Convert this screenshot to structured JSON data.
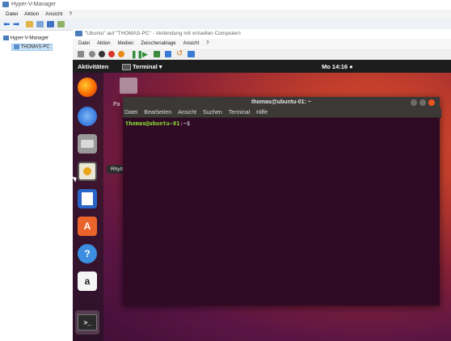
{
  "host": {
    "title": "Hyper-V-Manager",
    "menu": [
      "Datei",
      "Aktion",
      "Ansicht",
      "?"
    ],
    "tree": {
      "root": "Hyper-V-Manager",
      "child": "THOMAS-PC"
    }
  },
  "vm": {
    "title": "\"Ubuntu\" auf \"THOMAS-PC\" - Verbindung mit virtuellen Computern",
    "menu": [
      "Datei",
      "Aktion",
      "Medien",
      "Zwischenablage",
      "Ansicht",
      "?"
    ]
  },
  "ubuntu": {
    "activities": "Aktivitäten",
    "app_menu": "Terminal ▾",
    "clock": "Mo 14:16 ●",
    "tooltip": "Rhythmbox",
    "desktop_partial": "Pa",
    "dock": [
      {
        "icon": "firefox-icon",
        "color": "#e66000"
      },
      {
        "icon": "thunderbird-icon",
        "color": "#2a6fdb"
      },
      {
        "icon": "files-icon",
        "color": "#8a8a8a"
      },
      {
        "icon": "rhythmbox-icon",
        "color": "#e8e3d4"
      },
      {
        "icon": "writer-icon",
        "color": "#2a66c8"
      },
      {
        "icon": "software-center-icon",
        "color": "#e9632b"
      },
      {
        "icon": "help-icon",
        "color": "#3b8ee0"
      },
      {
        "icon": "amazon-icon",
        "color": "#f5f5f5"
      },
      {
        "icon": "terminal-icon",
        "color": "#2b2b2b"
      }
    ],
    "terminal": {
      "title": "thomas@ubuntu-01: ~",
      "menu": [
        "Datei",
        "Bearbeiten",
        "Ansicht",
        "Suchen",
        "Terminal",
        "Hilfe"
      ],
      "prompt_user": "thomas@ubuntu-01",
      "prompt_path": ":~$"
    }
  },
  "colors": {
    "ubuntu_orange": "#e95420",
    "terminal_bg": "#300a24",
    "prompt_green": "#8ae234",
    "prompt_blue": "#729fcf"
  }
}
